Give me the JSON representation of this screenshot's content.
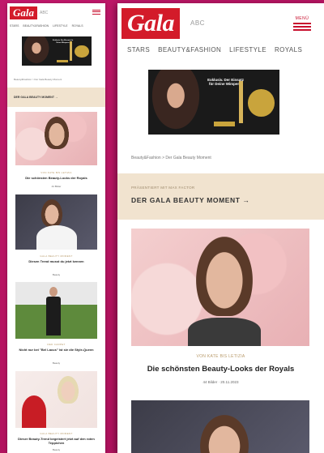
{
  "site": {
    "logo": "Gala",
    "abc": "ABC",
    "menu_label": "MENÜ",
    "nav": [
      "Stars",
      "Beauty&Fashion",
      "Lifestyle",
      "Royals"
    ]
  },
  "ad": {
    "text": "Exklusiv. Der Einsatz für Deine Wimpern."
  },
  "breadcrumb": "Beauty&Fashion > Der Gala Beauty Moment",
  "promo": {
    "sub": "Präsentiert mit Max Factor",
    "title": "Der Gala Beauty Moment →"
  },
  "featured": {
    "kicker": "Von Kate bis Letizia",
    "headline": "Die schönsten Beauty-Looks der Royals",
    "meta": "44 Bilder · 20.11.2023"
  },
  "small_cards": [
    {
      "kicker": "Von Kate bis Letizia",
      "headline": "Die schönsten Beauty-Looks der Royals",
      "meta": "44 Bilder"
    },
    {
      "kicker": "Gala Beauty Moment",
      "headline": "Diesen Trend musst du jetzt kennen",
      "meta": "Beauty"
    },
    {
      "kicker": "Red Carpet",
      "headline": "Nicht nur bei \"Bel Lacus\" ist sie die Style-Queen",
      "meta": "Beauty"
    },
    {
      "kicker": "Gala Beauty Moment",
      "headline": "Dieser Beauty-Trend begeistert jetzt auf den roten Teppichen",
      "meta": "Beauty"
    }
  ],
  "colors": {
    "brand_red": "#d31b2a",
    "background_magenta": "#b3135f",
    "promo_beige": "#f1e3cf"
  }
}
